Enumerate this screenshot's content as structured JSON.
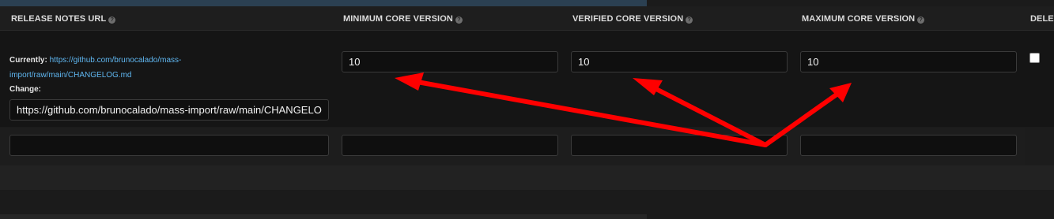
{
  "columns": {
    "release_notes_url": "RELEASE NOTES URL",
    "minimum_core_version": "MINIMUM CORE VERSION",
    "verified_core_version": "VERIFIED CORE VERSION",
    "maximum_core_version": "MAXIMUM CORE VERSION",
    "delete": "DELETE"
  },
  "row1": {
    "currently_label": "Currently:",
    "currently_url": "https://github.com/brunocalado/mass-import/raw/main/CHANGELOG.md",
    "change_label": "Change:",
    "change_value": "https://github.com/brunocalado/mass-import/raw/main/CHANGELOG.md",
    "minimum_core_version": "10",
    "verified_core_version": "10",
    "maximum_core_version": "10",
    "delete_checked": false
  },
  "row2": {
    "release_notes_value": "",
    "minimum_core_version": "",
    "verified_core_version": "",
    "maximum_core_version": ""
  },
  "icons": {
    "help": "help-circle-icon",
    "annotation": "red-arrow-annotation"
  },
  "colors": {
    "background": "#1b1b1b",
    "header_strip": "#2b4052",
    "link": "#5fb6f0",
    "annotation": "#ff0000"
  }
}
